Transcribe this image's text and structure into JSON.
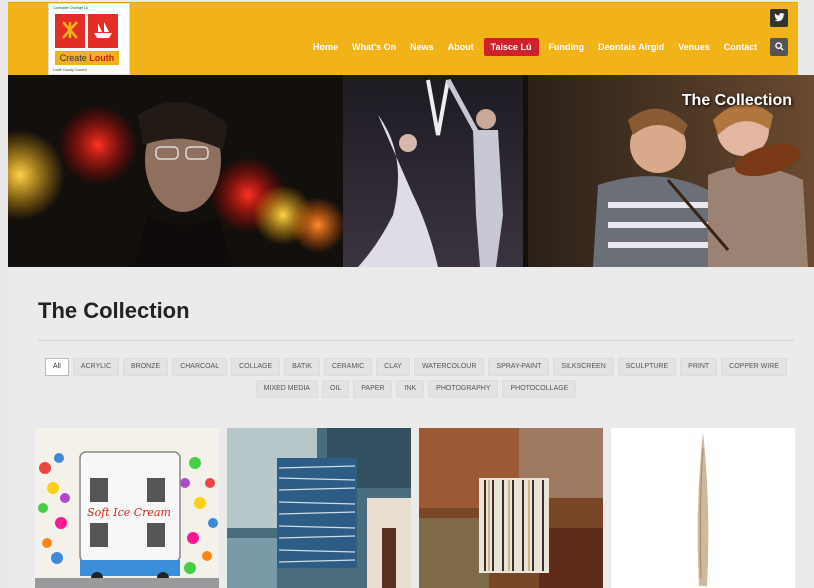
{
  "logo": {
    "top_line": "Comhairle Chontae Lú",
    "name_plain": "Create",
    "name_bold": "Louth",
    "bottom_line": "Louth County Council"
  },
  "nav": {
    "items": [
      {
        "label": "Home"
      },
      {
        "label": "What's On"
      },
      {
        "label": "News"
      },
      {
        "label": "About"
      },
      {
        "label": "Taisce Lú",
        "active": true
      },
      {
        "label": "Funding"
      },
      {
        "label": "Deontais Airgid"
      },
      {
        "label": "Venues"
      },
      {
        "label": "Contact"
      }
    ],
    "social_icon": "twitter-icon",
    "search_icon": "search-icon"
  },
  "banner": {
    "caption": "The Collection"
  },
  "main": {
    "title": "The Collection",
    "filters_row1": [
      "All",
      "ACRYLIC",
      "BRONZE",
      "CHARCOAL",
      "COLLAGE",
      "BATIK",
      "CERAMIC",
      "CLAY",
      "WATERCOLOUR",
      "SPRAY-PAINT",
      "SILKSCREEN",
      "SCULPTURE",
      "PRINT",
      "COPPER WIRE"
    ],
    "filters_row2": [
      "MIXED MEDIA",
      "OIL",
      "PAPER",
      "INK",
      "PHOTOGRAPHY",
      "PHOTOCOLLAGE"
    ],
    "active_filter": "All",
    "artwork_text": "Soft Ice Cream"
  },
  "colors": {
    "header": "#f2b318",
    "active_nav": "#d0202e",
    "logo_red": "#e52d27"
  }
}
